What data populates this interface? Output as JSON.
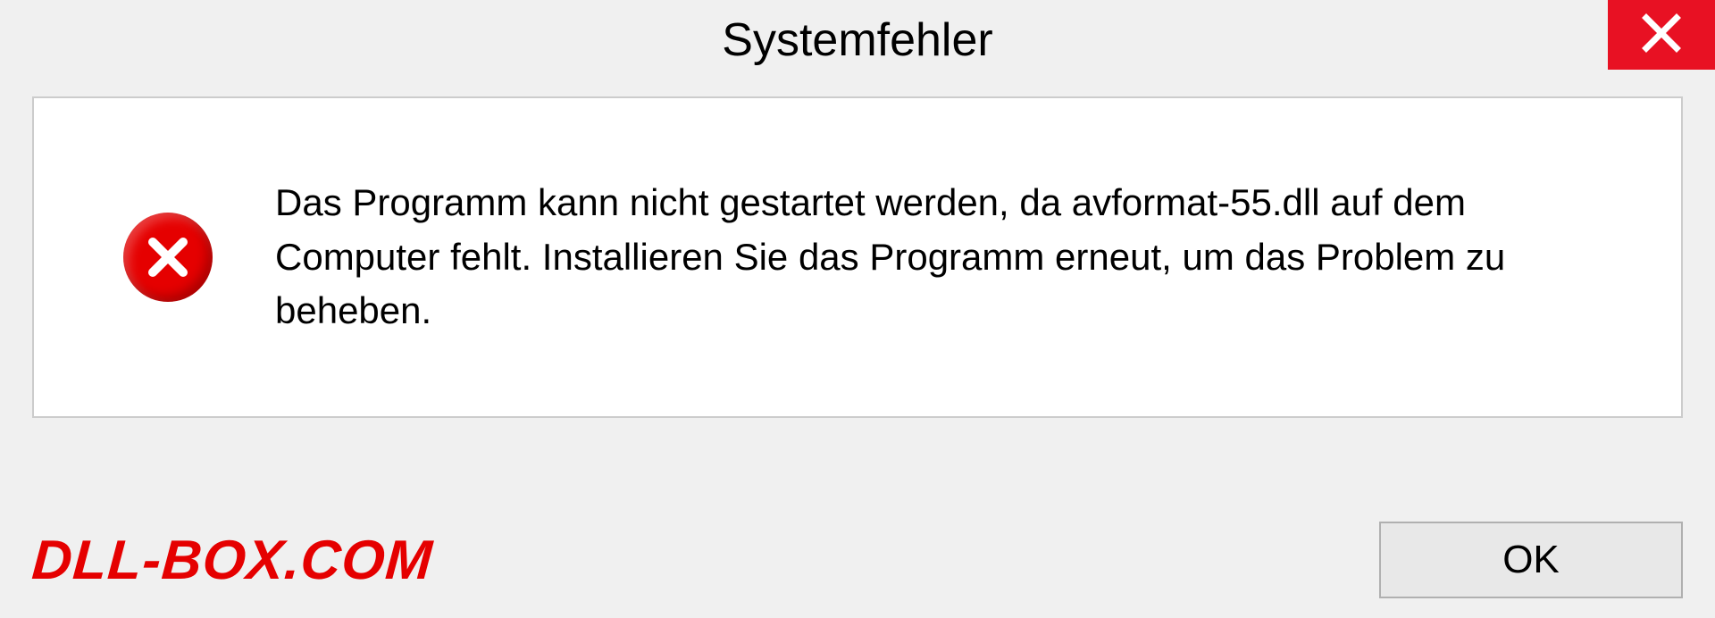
{
  "dialog": {
    "title": "Systemfehler",
    "message": "Das Programm kann nicht gestartet werden, da avformat-55.dll auf dem Computer fehlt. Installieren Sie das Programm erneut, um das Problem zu beheben.",
    "ok_label": "OK"
  },
  "watermark": "DLL-BOX.COM",
  "colors": {
    "close_red": "#e81123",
    "error_red": "#e50000",
    "watermark_red": "#e50000",
    "panel_bg": "#ffffff",
    "window_bg": "#f0f0f0"
  }
}
